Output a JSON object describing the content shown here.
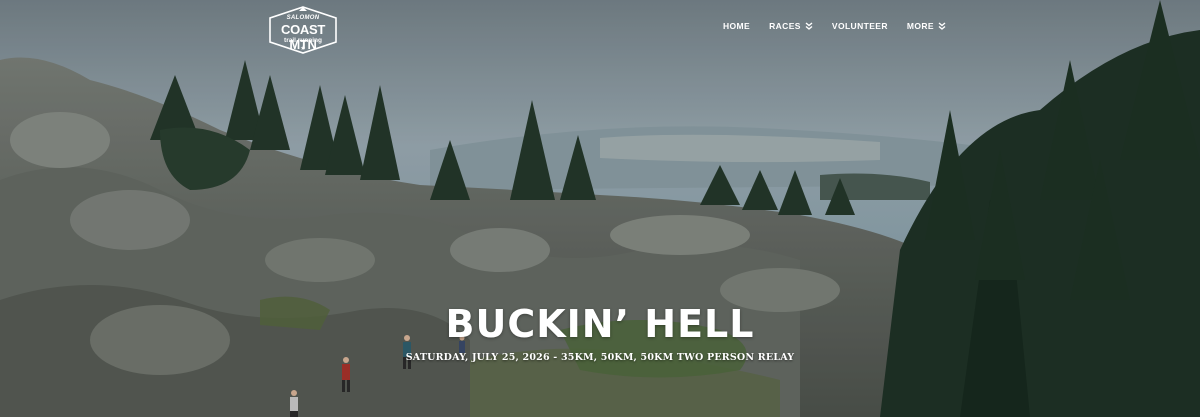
{
  "logo": {
    "sponsor": "SALOMON",
    "name": "COAST MTN",
    "subtitle": "trail running",
    "mark": "star-icon"
  },
  "nav": {
    "items": [
      {
        "label": "HOME",
        "dropdown": false
      },
      {
        "label": "RACES",
        "dropdown": true,
        "icon": "double-chevron-down-icon"
      },
      {
        "label": "VOLUNTEER",
        "dropdown": false
      },
      {
        "label": "MORE",
        "dropdown": true,
        "icon": "double-chevron-down-icon"
      }
    ]
  },
  "hero": {
    "title": "BUCKIN’ HELL",
    "subtitle": "SATURDAY, JULY 25, 2026 - 35KM, 50KM, 50KM TWO PERSON RELAY"
  },
  "colors": {
    "text": "#ffffff",
    "sky": "#7f9aa8",
    "rock": "#6f7570",
    "forest": "#23372a"
  }
}
